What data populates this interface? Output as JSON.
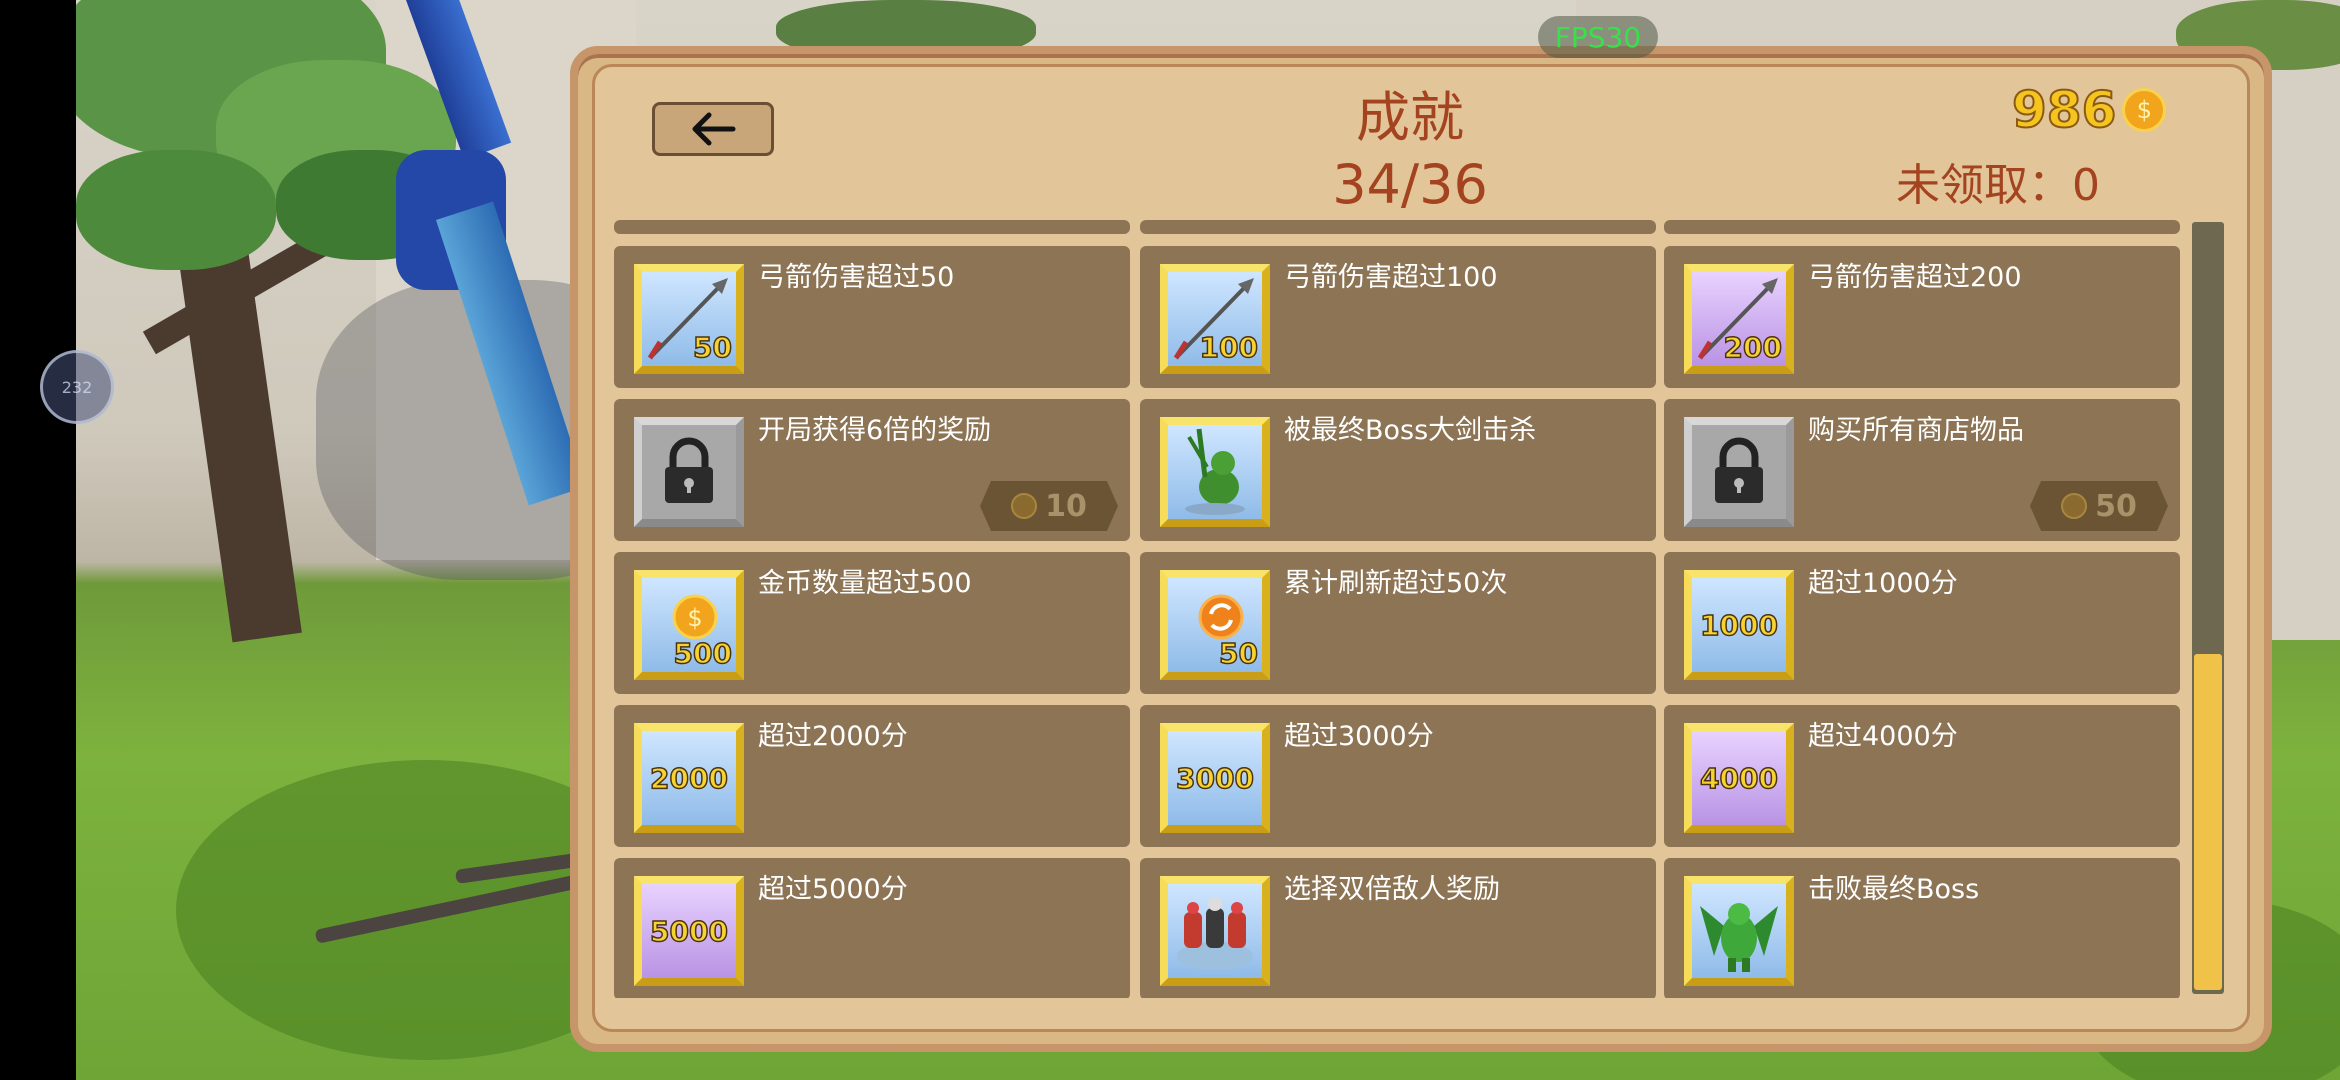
{
  "hud": {
    "fps": "FPS30",
    "joystick_label": "232"
  },
  "header": {
    "title": "成就",
    "progress": "34/36",
    "coins": "986",
    "coin_symbol": "$",
    "unclaimed": "未领取：0"
  },
  "achievements": [
    {
      "label": "弓箭伤害超过50",
      "icon": "arrow-icon",
      "badge": "50",
      "state": "done"
    },
    {
      "label": "弓箭伤害超过100",
      "icon": "arrow-icon",
      "badge": "100",
      "state": "done"
    },
    {
      "label": "弓箭伤害超过200",
      "icon": "arrow-icon",
      "badge": "200",
      "state": "done"
    },
    {
      "label": "开局获得6倍的奖励",
      "icon": "lock-icon",
      "reward": "10",
      "state": "locked"
    },
    {
      "label": "被最终Boss大剑击杀",
      "icon": "monster-icon",
      "state": "done"
    },
    {
      "label": "购买所有商店物品",
      "icon": "lock-icon",
      "reward": "50",
      "state": "locked"
    },
    {
      "label": "金币数量超过500",
      "icon": "coin-icon",
      "badge": "500",
      "state": "done"
    },
    {
      "label": "累计刷新超过50次",
      "icon": "refresh-icon",
      "badge": "50",
      "state": "done"
    },
    {
      "label": "超过1000分",
      "icon": "score-icon",
      "badge": "1000",
      "state": "done"
    },
    {
      "label": "超过2000分",
      "icon": "score-icon",
      "badge": "2000",
      "state": "done"
    },
    {
      "label": "超过3000分",
      "icon": "score-icon",
      "badge": "3000",
      "state": "done"
    },
    {
      "label": "超过4000分",
      "icon": "score-icon",
      "badge": "4000",
      "state": "done"
    },
    {
      "label": "超过5000分",
      "icon": "score-icon",
      "badge": "5000",
      "state": "done"
    },
    {
      "label": "选择双倍敌人奖励",
      "icon": "enemies-icon",
      "state": "done"
    },
    {
      "label": "击败最终Boss",
      "icon": "dragon-icon",
      "state": "done"
    }
  ],
  "scroll": {
    "position": 0.56
  },
  "colors": {
    "title": "#a3431f",
    "coin": "#f6c51d",
    "card": "#8c7455",
    "icon_frame": "#f0cf3a"
  }
}
